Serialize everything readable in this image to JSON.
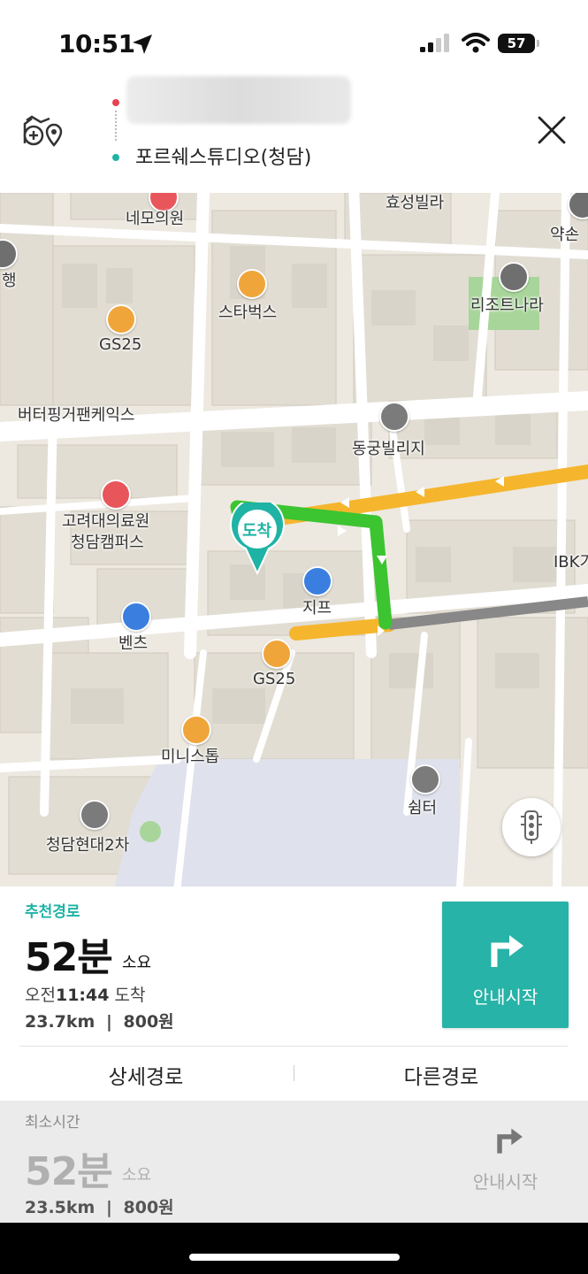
{
  "status_bar": {
    "time": "10:51",
    "battery": "57"
  },
  "header": {
    "destination": "포르쉐스튜디오(청담)",
    "origin_obscured": true
  },
  "map": {
    "labels": {
      "nemo": "네모의원",
      "hyoseong": "효성빌라",
      "yakson": "약손",
      "bank_partial": "행",
      "starbucks": "스타벅스",
      "gs25_top": "GS25",
      "resort": "리조트나라",
      "butter": "버터핑거팬케익스",
      "donggung": "동궁빌리지",
      "korea_univ_1": "고려대의료원",
      "korea_univ_2": "청담캠퍼스",
      "jeep": "지프",
      "benz": "벤츠",
      "gs25_mid": "GS25",
      "ibk": "IBK기",
      "ministop": "미니스톱",
      "shelter": "쉼터",
      "hyundai": "청담현대2차",
      "arrival_pin": "도착"
    },
    "colors": {
      "route_green": "#3cc431",
      "route_yellow": "#f5b62e",
      "route_gray": "#888888",
      "teal": "#1fb3a5"
    }
  },
  "route": {
    "tag": "추천경로",
    "duration_value": "52분",
    "duration_unit": "소요",
    "arrival_prefix": "오전",
    "arrival_time": "11:44",
    "arrival_suffix": "도착",
    "distance": "23.7km",
    "separator": "|",
    "toll": "800원",
    "start_label": "안내시작",
    "tab_detail": "상세경로",
    "tab_other": "다른경로"
  },
  "alt_route": {
    "tag": "최소시간",
    "duration_value": "52분",
    "duration_unit": "소요",
    "distance": "23.5km",
    "separator": "|",
    "toll": "800원",
    "start_label": "안내시작"
  }
}
